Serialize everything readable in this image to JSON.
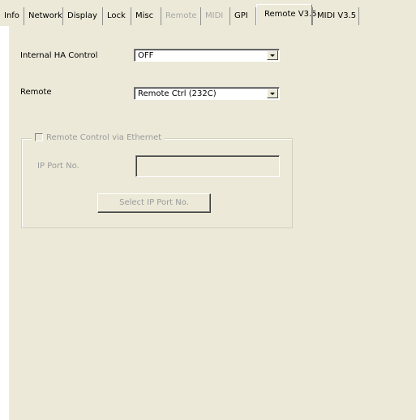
{
  "tabs": [
    {
      "label": "Info",
      "state": "normal"
    },
    {
      "label": "Network",
      "state": "normal"
    },
    {
      "label": "Display",
      "state": "normal"
    },
    {
      "label": "Lock",
      "state": "normal"
    },
    {
      "label": "Misc",
      "state": "normal"
    },
    {
      "label": "Remote",
      "state": "disabled"
    },
    {
      "label": "MIDI",
      "state": "disabled"
    },
    {
      "label": "GPI",
      "state": "normal"
    },
    {
      "label": "Remote V3.5",
      "state": "active"
    },
    {
      "label": "MIDI V3.5",
      "state": "normal"
    }
  ],
  "form": {
    "internal_ha_control": {
      "label": "Internal HA Control",
      "value": "OFF"
    },
    "remote": {
      "label": "Remote",
      "value": "Remote Ctrl (232C)"
    },
    "ethernet_group": {
      "checkbox_label": "Remote Control via Ethernet",
      "checked": false,
      "ip_port_label": "IP Port No.",
      "ip_port_value": "",
      "select_button_label": "Select IP Port No."
    }
  },
  "icons": {
    "dropdown": "chevron-down-icon"
  }
}
